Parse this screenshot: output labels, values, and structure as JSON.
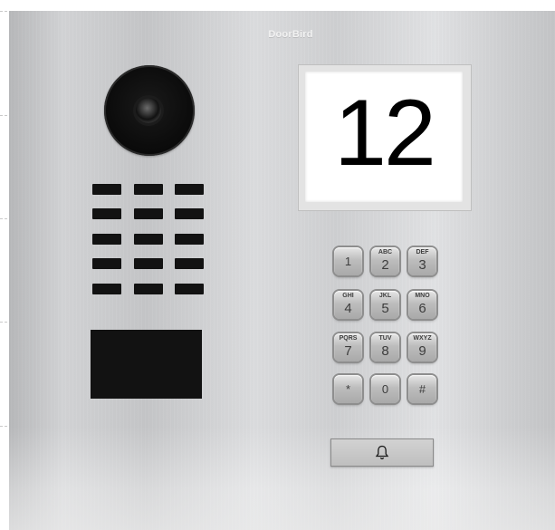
{
  "brand": "DoorBird",
  "display": {
    "number": "12"
  },
  "keypad": [
    {
      "sub": "",
      "num": "1",
      "name": "key-1"
    },
    {
      "sub": "ABC",
      "num": "2",
      "name": "key-2"
    },
    {
      "sub": "DEF",
      "num": "3",
      "name": "key-3"
    },
    {
      "sub": "GHI",
      "num": "4",
      "name": "key-4"
    },
    {
      "sub": "JKL",
      "num": "5",
      "name": "key-5"
    },
    {
      "sub": "MNO",
      "num": "6",
      "name": "key-6"
    },
    {
      "sub": "PQRS",
      "num": "7",
      "name": "key-7"
    },
    {
      "sub": "TUV",
      "num": "8",
      "name": "key-8"
    },
    {
      "sub": "WXYZ",
      "num": "9",
      "name": "key-9"
    },
    {
      "sub": "",
      "num": "*",
      "name": "key-star"
    },
    {
      "sub": "",
      "num": "0",
      "name": "key-0"
    },
    {
      "sub": "",
      "num": "#",
      "name": "key-hash"
    }
  ],
  "icons": {
    "camera": "camera-lens-icon",
    "bell": "bell-icon"
  }
}
